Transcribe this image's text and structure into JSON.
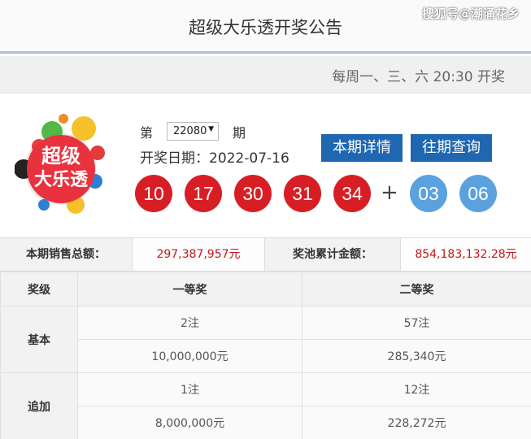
{
  "header": {
    "title": "超级大乐透开奖公告",
    "watermark": "搜狐号@潮涌花乡"
  },
  "schedule": "每周一、三、六 20:30 开奖",
  "logo": {
    "text_line1": "超级",
    "text_line2": "大乐透"
  },
  "issue": {
    "prefix": "第",
    "value": "22080",
    "suffix": "期"
  },
  "draw_date": "开奖日期：2022-07-16",
  "buttons": {
    "detail": "本期详情",
    "history": "往期查询"
  },
  "balls": {
    "front": [
      "10",
      "17",
      "30",
      "31",
      "34"
    ],
    "plus": "+",
    "back": [
      "03",
      "06"
    ],
    "front_color": "#d81e25",
    "back_color": "#5aa1de"
  },
  "sales": {
    "total_label": "本期销售总额：",
    "total_value": "297,387,957元",
    "pool_label": "奖池累计金额：",
    "pool_value": "854,183,132.28元"
  },
  "prize_table": {
    "headers": [
      "奖级",
      "一等奖",
      "二等奖"
    ],
    "rows": [
      {
        "label": "基本",
        "first_count": "2注",
        "first_amount": "10,000,000元",
        "second_count": "57注",
        "second_amount": "285,340元"
      },
      {
        "label": "追加",
        "first_count": "1注",
        "first_amount": "8,000,000元",
        "second_count": "12注",
        "second_amount": "228,272元"
      }
    ]
  },
  "colors": {
    "button_blue": "#1f67b1",
    "amount_red": "#c4161c"
  }
}
